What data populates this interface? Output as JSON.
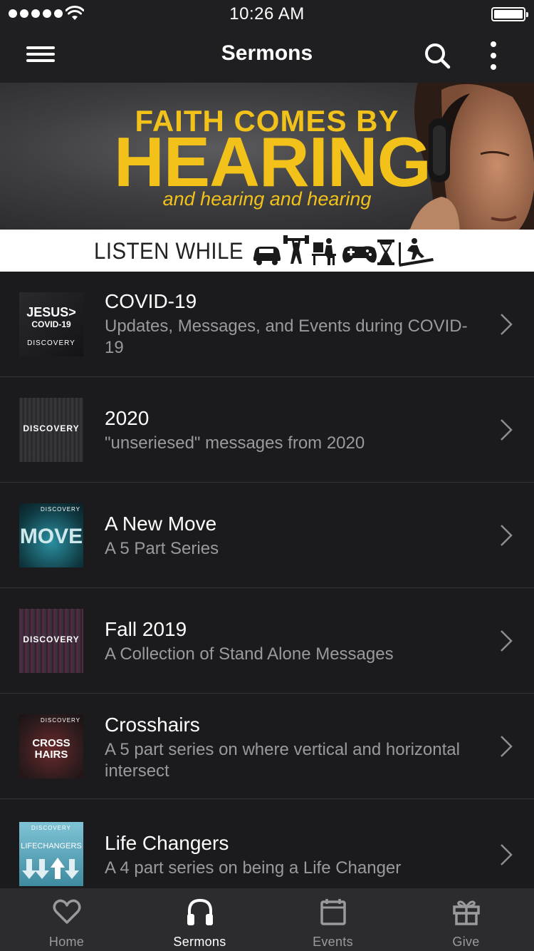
{
  "status_bar": {
    "time": "10:26 AM"
  },
  "app_bar": {
    "title": "Sermons"
  },
  "banner": {
    "headline_top": "FAITH COMES BY",
    "headline_main": "HEARING",
    "headline_sub": "and hearing and hearing",
    "listen_text": "LISTEN WHILE"
  },
  "series": [
    {
      "title": "COVID-19",
      "subtitle": "Updates, Messages, and Events during COVID-19",
      "thumb_line1": "JESUS>",
      "thumb_line2": "COVID-19",
      "thumb_brand": "DISCOVERY"
    },
    {
      "title": "2020",
      "subtitle": "\"unseriesed\" messages from 2020",
      "thumb_brand": "DISCOVERY"
    },
    {
      "title": "A New Move",
      "subtitle": "A 5 Part Series",
      "thumb_brand": "DISCOVERY",
      "thumb_word": "MOVE"
    },
    {
      "title": "Fall 2019",
      "subtitle": "A Collection of Stand Alone Messages",
      "thumb_brand": "DISCOVERY"
    },
    {
      "title": "Crosshairs",
      "subtitle": "A 5 part series on where vertical and horizontal intersect",
      "thumb_brand": "DISCOVERY",
      "thumb_word1": "CROSS",
      "thumb_word2": "HAIRS"
    },
    {
      "title": "Life Changers",
      "subtitle": "A 4 part series on being a Life Changer",
      "thumb_brand": "DISCOVERY",
      "thumb_word": "LIFECHANGERS"
    }
  ],
  "tabs": [
    {
      "label": "Home",
      "icon": "heart-icon"
    },
    {
      "label": "Sermons",
      "icon": "headphones-icon",
      "active": true
    },
    {
      "label": "Events",
      "icon": "calendar-icon"
    },
    {
      "label": "Give",
      "icon": "gift-icon"
    }
  ],
  "colors": {
    "accent": "#f2c21b",
    "background": "#1b1b1d",
    "tab_bar": "#2c2c2e",
    "subtitle": "#9a9a9c"
  }
}
